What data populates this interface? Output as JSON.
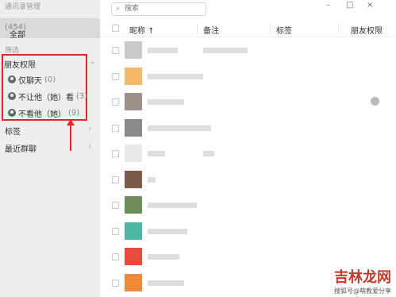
{
  "sidebar": {
    "title": "通讯录管理",
    "all_label": "全部",
    "all_count": "(454)",
    "filter_label": "筛选",
    "permissions": {
      "header": "朋友权限",
      "items": [
        {
          "label": "仅聊天",
          "count": "(0)",
          "icon": "chat-only-icon"
        },
        {
          "label": "不让他（她）看",
          "count": "(3)",
          "icon": "hide-my-moments-icon"
        },
        {
          "label": "不看他（她）",
          "count": "(9)",
          "icon": "hide-their-moments-icon"
        }
      ]
    },
    "tags_label": "标签",
    "recent_groups_label": "最近群聊"
  },
  "search": {
    "placeholder": "搜索",
    "value": ""
  },
  "window_controls": {
    "minimize": "–",
    "maximize": "□",
    "close": "×"
  },
  "table": {
    "headers": {
      "nickname": "昵称 ↑",
      "remark": "备注",
      "tags": "标签",
      "permission": "朋友权限"
    },
    "rows": [
      {
        "avatar_color": "#c9c9c9",
        "has_perm_icon": false
      },
      {
        "avatar_color": "#f3b86a",
        "has_perm_icon": false
      },
      {
        "avatar_color": "#a08f86",
        "has_perm_icon": true
      },
      {
        "avatar_color": "#8a8a8a",
        "has_perm_icon": false
      },
      {
        "avatar_color": "#e8e8e8",
        "has_perm_icon": false
      },
      {
        "avatar_color": "#7a5a4a",
        "has_perm_icon": false
      },
      {
        "avatar_color": "#6f8d5a",
        "has_perm_icon": false
      },
      {
        "avatar_color": "#4fb8a4",
        "has_perm_icon": false
      },
      {
        "avatar_color": "#e74c3c",
        "has_perm_icon": false
      },
      {
        "avatar_color": "#f08a3a",
        "has_perm_icon": false
      }
    ]
  },
  "watermark": {
    "main": "吉林龙网",
    "sub": "搜狐号@萌教爱分享"
  },
  "colors": {
    "highlight": "#e0252b",
    "sidebar_bg": "#eeeeee",
    "selected_bg": "#d9d9d9"
  }
}
